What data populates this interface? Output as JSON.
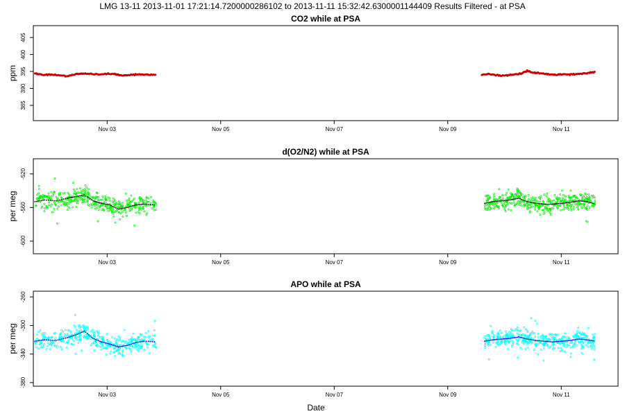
{
  "figure": {
    "title": "LMG   13-11    2013-11-01 17:21:14.7200000286102 to 2013-11-11 15:32:42.6300001144409    Results Filtered - at PSA",
    "xlabel": "Date"
  },
  "chart_data": [
    {
      "type": "scatter",
      "title": "CO2 while at PSA",
      "xlabel": "Date",
      "ylabel": "ppm",
      "ylim": [
        380.5,
        408.5
      ],
      "yticks": [
        385,
        390,
        395,
        400,
        405
      ],
      "xlim": [
        1.7,
        12.0
      ],
      "xticks": [
        {
          "value": 3,
          "label": "Nov 03"
        },
        {
          "value": 5,
          "label": "Nov 05"
        },
        {
          "value": 7,
          "label": "Nov 07"
        },
        {
          "value": 9,
          "label": "Nov 09"
        },
        {
          "value": 11,
          "label": "Nov 11"
        }
      ],
      "grid": false,
      "series": [
        {
          "color": "#cc0000",
          "kind": "points",
          "segments": [
            {
              "x": [
                1.73,
                1.85,
                2.0,
                2.15,
                2.3,
                2.45,
                2.55,
                2.7,
                2.85,
                3.0,
                3.15,
                3.25,
                3.4,
                3.55,
                3.7,
                3.87
              ],
              "y": [
                394.4,
                394.1,
                394.0,
                393.9,
                393.6,
                394.2,
                394.4,
                394.3,
                394.1,
                394.3,
                394.2,
                393.8,
                394.0,
                394.1,
                394.1,
                394.1
              ]
            },
            {
              "x": [
                9.6,
                9.75,
                9.9,
                10.05,
                10.2,
                10.3,
                10.4,
                10.5,
                10.6,
                10.75,
                10.9,
                11.05,
                11.2,
                11.35,
                11.5,
                11.6
              ],
              "y": [
                394.0,
                394.2,
                393.9,
                393.8,
                394.1,
                394.4,
                395.2,
                394.7,
                394.5,
                394.2,
                394.0,
                394.2,
                394.1,
                394.3,
                394.6,
                394.9
              ]
            }
          ]
        }
      ]
    },
    {
      "type": "scatter",
      "title": "d(O2/N2) while at PSA",
      "xlabel": "Date",
      "ylabel": "per meg",
      "ylim": [
        -615,
        -502
      ],
      "yticks": [
        -600,
        -560,
        -520
      ],
      "xlim": [
        1.7,
        12.0
      ],
      "xticks": [
        {
          "value": 3,
          "label": "Nov 03"
        },
        {
          "value": 5,
          "label": "Nov 05"
        },
        {
          "value": 7,
          "label": "Nov 07"
        },
        {
          "value": 9,
          "label": "Nov 09"
        },
        {
          "value": 11,
          "label": "Nov 11"
        }
      ],
      "grid": false,
      "series": [
        {
          "color": "#00ee00",
          "kind": "band",
          "spread": 8,
          "segments": [
            {
              "x": [
                1.73,
                1.9,
                2.1,
                2.3,
                2.45,
                2.6,
                2.75,
                2.9,
                3.05,
                3.2,
                3.35,
                3.5,
                3.65,
                3.87
              ],
              "y": [
                -553,
                -551,
                -552,
                -549,
                -547,
                -545,
                -552,
                -555,
                -557,
                -562,
                -560,
                -557,
                -556,
                -557
              ]
            },
            {
              "x": [
                9.65,
                9.8,
                9.95,
                10.1,
                10.25,
                10.4,
                10.55,
                10.7,
                10.85,
                11.0,
                11.15,
                11.3,
                11.45,
                11.6
              ],
              "y": [
                -555,
                -553,
                -552,
                -551,
                -549,
                -553,
                -555,
                -556,
                -556,
                -555,
                -554,
                -552,
                -553,
                -556
              ]
            }
          ]
        },
        {
          "color": "#000000",
          "kind": "line",
          "segments": [
            {
              "x": [
                1.73,
                1.9,
                2.1,
                2.3,
                2.45,
                2.6,
                2.75,
                2.9,
                3.05,
                3.2,
                3.35,
                3.5,
                3.65,
                3.87
              ],
              "y": [
                -553,
                -551,
                -552,
                -549,
                -547,
                -545,
                -552,
                -555,
                -557,
                -562,
                -560,
                -557,
                -556,
                -557
              ]
            },
            {
              "x": [
                9.65,
                9.8,
                9.95,
                10.1,
                10.25,
                10.4,
                10.55,
                10.7,
                10.85,
                11.0,
                11.15,
                11.3,
                11.45,
                11.6
              ],
              "y": [
                -555,
                -553,
                -552,
                -551,
                -549,
                -553,
                -555,
                -556,
                -556,
                -555,
                -554,
                -552,
                -553,
                -556
              ]
            }
          ]
        }
      ]
    },
    {
      "type": "scatter",
      "title": "APO while at PSA",
      "xlabel": "Date",
      "ylabel": "per meg",
      "ylim": [
        -385,
        -252
      ],
      "yticks": [
        -380,
        -340,
        -300,
        -260
      ],
      "xlim": [
        1.7,
        12.0
      ],
      "xticks": [
        {
          "value": 3,
          "label": "Nov 03"
        },
        {
          "value": 5,
          "label": "Nov 05"
        },
        {
          "value": 7,
          "label": "Nov 07"
        },
        {
          "value": 9,
          "label": "Nov 09"
        },
        {
          "value": 11,
          "label": "Nov 11"
        }
      ],
      "grid": false,
      "series": [
        {
          "color": "#00ffff",
          "kind": "band",
          "spread": 9,
          "segments": [
            {
              "x": [
                1.73,
                1.9,
                2.1,
                2.3,
                2.45,
                2.6,
                2.75,
                2.9,
                3.05,
                3.2,
                3.35,
                3.5,
                3.65,
                3.87
              ],
              "y": [
                -322,
                -320,
                -321,
                -317,
                -313,
                -308,
                -318,
                -323,
                -326,
                -330,
                -328,
                -324,
                -322,
                -323
              ]
            },
            {
              "x": [
                9.65,
                9.8,
                9.95,
                10.1,
                10.25,
                10.4,
                10.55,
                10.7,
                10.85,
                11.0,
                11.15,
                11.3,
                11.45,
                11.6
              ],
              "y": [
                -322,
                -320,
                -319,
                -318,
                -316,
                -319,
                -321,
                -322,
                -323,
                -322,
                -321,
                -319,
                -320,
                -322
              ]
            }
          ]
        },
        {
          "color": "#0000cc",
          "kind": "line",
          "segments": [
            {
              "x": [
                1.73,
                1.9,
                2.1,
                2.3,
                2.45,
                2.6,
                2.75,
                2.9,
                3.05,
                3.2,
                3.35,
                3.5,
                3.65,
                3.87
              ],
              "y": [
                -322,
                -320,
                -321,
                -317,
                -313,
                -308,
                -318,
                -323,
                -326,
                -330,
                -328,
                -324,
                -322,
                -323
              ]
            },
            {
              "x": [
                9.65,
                9.8,
                9.95,
                10.1,
                10.25,
                10.4,
                10.55,
                10.7,
                10.85,
                11.0,
                11.15,
                11.3,
                11.45,
                11.6
              ],
              "y": [
                -322,
                -320,
                -319,
                -318,
                -316,
                -319,
                -321,
                -322,
                -323,
                -322,
                -321,
                -319,
                -320,
                -322
              ]
            }
          ]
        }
      ]
    }
  ]
}
